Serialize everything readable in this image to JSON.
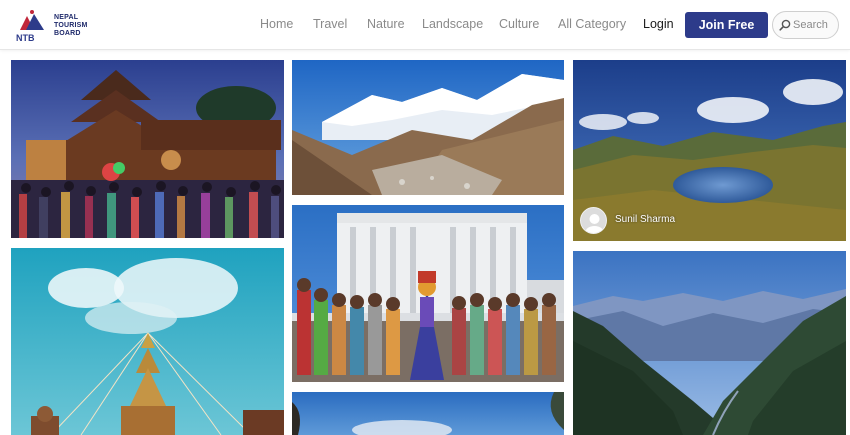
{
  "brand": {
    "logo_text": "NEPAL\nTOURISM\nBOARD",
    "logo_mark": "NTB",
    "brand_color": "#2d3b8a"
  },
  "nav": {
    "items": [
      "Home",
      "Travel",
      "Nature",
      "Landscape",
      "Culture",
      "All Category"
    ],
    "login": "Login",
    "join": "Join Free"
  },
  "search": {
    "placeholder": "Search",
    "icon": "search-icon"
  },
  "gallery": {
    "photos": [
      {
        "subject": "temple-festival-crowd"
      },
      {
        "subject": "snow-mountains-valley"
      },
      {
        "subject": "mountain-lake",
        "author": "Sunil Sharma"
      },
      {
        "subject": "stupa-prayer-flags"
      },
      {
        "subject": "palace-dancer-crowd"
      },
      {
        "subject": "mountain-range-valley"
      },
      {
        "subject": "sky-partial"
      }
    ]
  }
}
